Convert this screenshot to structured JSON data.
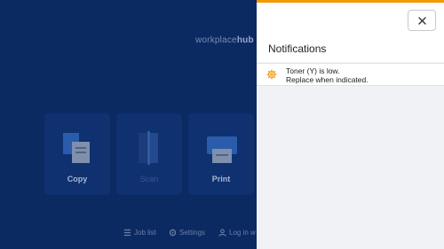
{
  "home": {
    "brand_prefix": "workplace",
    "brand_suffix": "hub",
    "tiles": [
      {
        "label": "Copy"
      },
      {
        "label": "Scan"
      },
      {
        "label": "Print"
      }
    ],
    "bottom_bar": {
      "job_list": "Job list",
      "settings": "Settings",
      "log_in": "Log in w"
    }
  },
  "notifications": {
    "title": "Notifications",
    "accent_color": "#f39800",
    "items": [
      {
        "icon": "gear-warning-icon",
        "line1": "Toner (Y) is low.",
        "line2": "Replace when indicated."
      }
    ]
  }
}
